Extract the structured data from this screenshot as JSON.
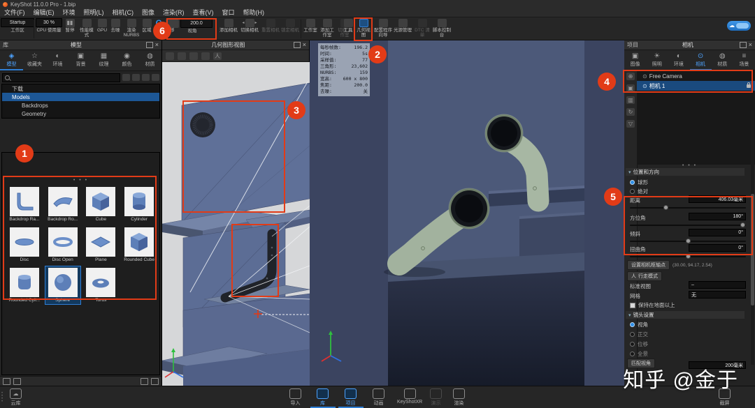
{
  "window": {
    "title": "KeyShot 11.0.0 Pro  -  1.bip"
  },
  "menu": {
    "items": [
      "文件(F)",
      "编辑(E)",
      "环境",
      "照明(L)",
      "相机(C)",
      "图像",
      "渲染(R)",
      "查看(V)",
      "窗口",
      "帮助(H)"
    ]
  },
  "toolbar": {
    "workspace_value": "Startup",
    "workspace_label": "工作区",
    "cpu_value": "30 %",
    "cpu_label": "CPU 使用量",
    "pause_label": "暂停",
    "perf_label": "性能模式",
    "gpu_label": "GPU",
    "denoise_label": "去噪",
    "nurbs_label": "渲染 NURBS",
    "region_label": "区域",
    "tumble_label": "翻转",
    "pan_label": "平移",
    "perspective_label": "视角",
    "perspective_value": "200.0",
    "add_camera_label": "添加相机",
    "cycle_camera_label": "切换相机",
    "reset_camera_label": "重置相机",
    "lock_camera_label": "锁定相机",
    "studio_label": "工作室",
    "add_studio_label": "添加工作室",
    "cycle_studio_label": "切换工作室",
    "tools_label": "工具",
    "geometry_view_label": "几何视图",
    "configurator_label": "配置程序向导",
    "light_manager_label": "光源管理",
    "dtc_label": "DTC 清单",
    "script_console_label": "脚本控制台"
  },
  "icons": {
    "pause": "▮▮",
    "c_logo": "C",
    "dots": "• • •",
    "model": "◈",
    "star": "☆",
    "environment": "◐",
    "background": "▣",
    "texture": "▦",
    "color": "◉",
    "material": "◍",
    "image": "▣",
    "lighting": "☀",
    "camera": "⊙",
    "scene": "≡",
    "cloud": "☁",
    "arrow_left": "◂",
    "arrow_right": "▸",
    "walk": "人",
    "gear": "⚙",
    "plus": "⊕",
    "copy": "▣",
    "grid": "▦",
    "refresh": "↻",
    "save": "▽",
    "trash": "▥",
    "person": "人"
  },
  "library": {
    "panel_title": "库",
    "bar_title": "模型",
    "tabs": [
      {
        "label": "模型"
      },
      {
        "label": "收藏夹"
      },
      {
        "label": "环境"
      },
      {
        "label": "背景"
      },
      {
        "label": "纹理"
      },
      {
        "label": "颜色"
      },
      {
        "label": "材质"
      }
    ],
    "tree": [
      {
        "label": "下载"
      },
      {
        "label": "Models"
      },
      {
        "label": "Backdrops"
      },
      {
        "label": "Geometry"
      }
    ],
    "models": [
      {
        "label": "Backdrop Ra..."
      },
      {
        "label": "Backdrop Ro..."
      },
      {
        "label": "Cube"
      },
      {
        "label": "Cylinder"
      },
      {
        "label": "Disc"
      },
      {
        "label": "Disc Open"
      },
      {
        "label": "Plane"
      },
      {
        "label": "Rounded Cube"
      },
      {
        "label": "Rounded Cyli..."
      },
      {
        "label": "Sphere"
      },
      {
        "label": "Torus"
      }
    ]
  },
  "geometry": {
    "panel_title": "几何图形视图"
  },
  "hud": {
    "rows": [
      {
        "label": "每秒帧数:",
        "value": "196.2"
      },
      {
        "label": "时间:",
        "value": "5s"
      },
      {
        "label": "采样值:",
        "value": "77"
      },
      {
        "label": "三角形:",
        "value": "23,602"
      },
      {
        "label": "NURBS:",
        "value": "159"
      },
      {
        "label": "宽高:",
        "value": "600 x 800"
      },
      {
        "label": "焦距:",
        "value": "200.0"
      },
      {
        "label": "去噪:",
        "value": "关"
      }
    ]
  },
  "project": {
    "panel_title": "项目",
    "bar_title": "相机",
    "tabs": [
      {
        "label": "图像"
      },
      {
        "label": "照明"
      },
      {
        "label": "环境"
      },
      {
        "label": "相机"
      },
      {
        "label": "材质"
      },
      {
        "label": "场景"
      }
    ],
    "cameras": [
      {
        "name": "Free Camera"
      },
      {
        "name": "相机 1"
      }
    ],
    "position_section": "位置和方向",
    "radio_spherical": "球形",
    "radio_absolute": "绝对",
    "sliders": [
      {
        "label": "距离",
        "value": "406.03毫米"
      },
      {
        "label": "方位角",
        "value": "180°"
      },
      {
        "label": "倾斜",
        "value": "0°"
      },
      {
        "label": "扭曲角",
        "value": "0°"
      }
    ],
    "pivot_button": "设置相机枢轴点",
    "pivot_coords": "(30.00, 94.17, 2.54)",
    "walk_button": "行走模式",
    "standard_view_label": "标准视图",
    "standard_view_value": "–",
    "grid_label": "网格",
    "grid_value": "无",
    "keep_above_ground": "保持在地面以上",
    "lens_section": "镜头设置",
    "lens_options": [
      {
        "label": "视角"
      },
      {
        "label": "正交"
      },
      {
        "label": "位移"
      },
      {
        "label": "全景"
      }
    ],
    "match_button": "匹配视角",
    "focal_value": "200毫米"
  },
  "bottom": {
    "items": [
      {
        "label": "云库"
      },
      {
        "label": "导入"
      },
      {
        "label": "库"
      },
      {
        "label": "项目"
      },
      {
        "label": "动画"
      },
      {
        "label": "KeyShotXR"
      },
      {
        "label": "演示"
      },
      {
        "label": "渲染"
      },
      {
        "label": "截屏"
      }
    ]
  },
  "watermark": {
    "text": "知乎 @金于"
  },
  "annotations": {
    "labels": [
      "1",
      "2",
      "3",
      "4",
      "5",
      "6"
    ]
  }
}
